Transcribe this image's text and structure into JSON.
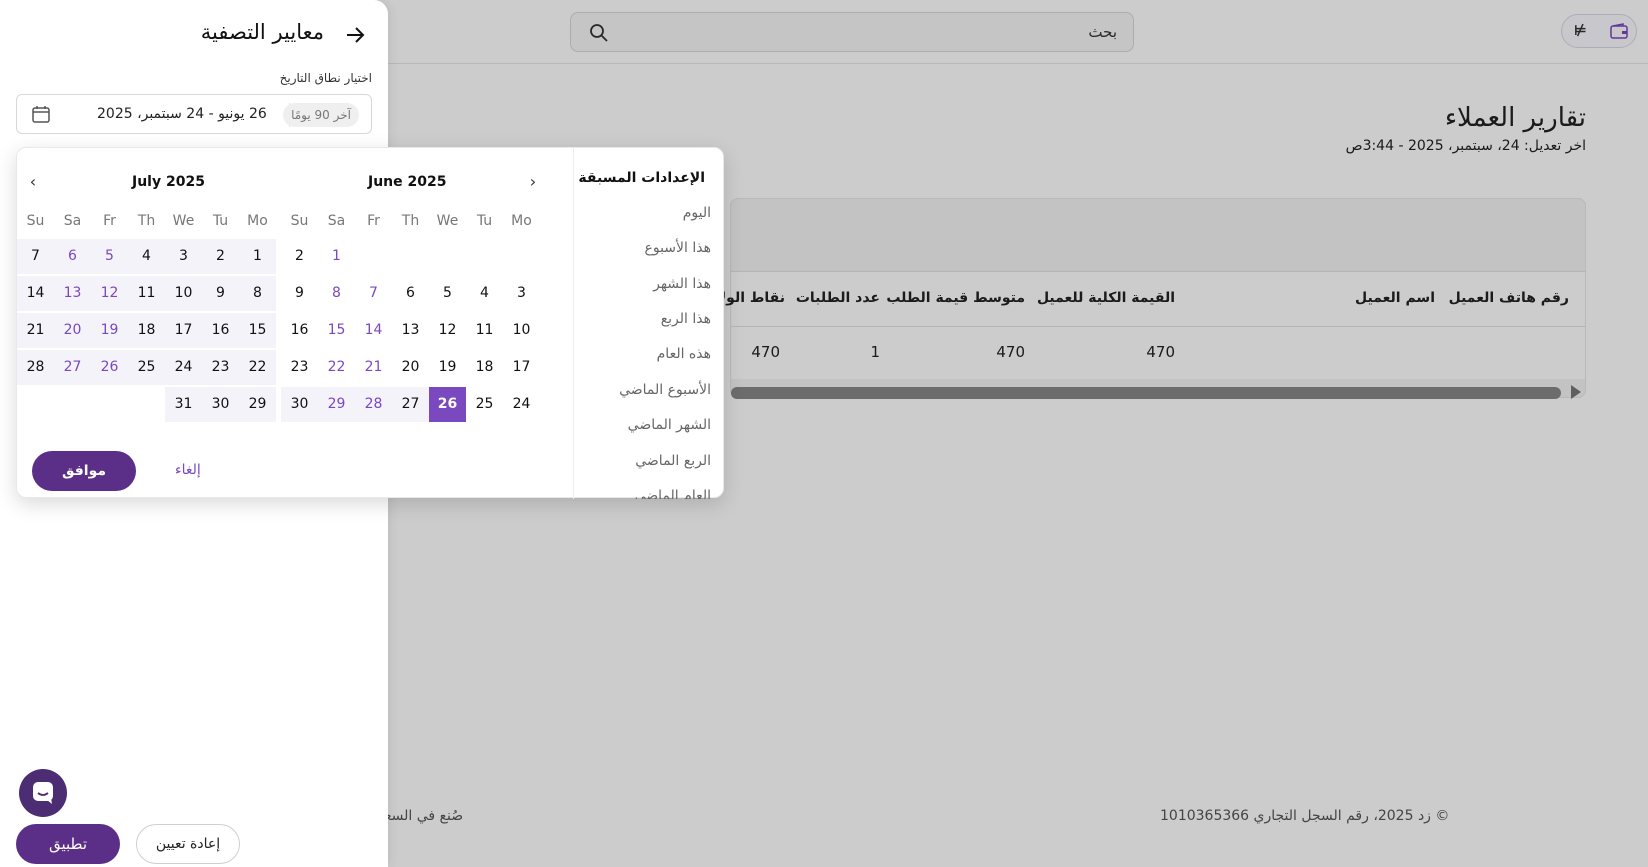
{
  "topbar": {
    "search_placeholder": "بحث",
    "currency_symbol": "⃁"
  },
  "page": {
    "title": "تقارير العملاء",
    "subtitle": "اخر تعديل: 24، سبتمبر، 2025 - 3:44ص"
  },
  "table": {
    "headers": [
      "رقم هاتف العميل",
      "اسم العميل",
      "القيمة الكلية للعميل",
      "متوسط قيمة الطلب",
      "عدد الطلبات",
      "نقاط الولاء"
    ],
    "row": [
      "",
      "",
      "470",
      "470",
      "1",
      "470"
    ]
  },
  "footer": {
    "copyright": "© زد 2025، رقم السجل التجاري 1010365366",
    "made_in": "صُنع في السعودية"
  },
  "filter_panel": {
    "title": "معايير التصفية",
    "range_label": "اختيار نطاق التاريخ",
    "range_value": "26 يونيو - 24 سبتمبر، 2025",
    "range_badge": "آخر 90 يومًا",
    "apply_label": "تطبيق",
    "reset_label": "إعادة تعيين"
  },
  "picker": {
    "presets_title": "الإعدادات المسبقة",
    "presets": [
      "اليوم",
      "هذا الأسبوع",
      "هذا الشهر",
      "هذا الربع",
      "هذه العام",
      "الأسبوع الماضي",
      "الشهر الماضي",
      "الربع الماضي",
      "العام الماضي"
    ],
    "weekdays": [
      "Mo",
      "Tu",
      "We",
      "Th",
      "Fr",
      "Sa",
      "Su"
    ],
    "months": [
      {
        "title": "June 2025",
        "first_weekday": 6,
        "days": 30,
        "range_from": 26
      },
      {
        "title": "July 2025",
        "first_weekday": 1,
        "days": 31,
        "range_from": 1
      }
    ],
    "selected_day": 26,
    "ok_label": "موافق",
    "cancel_label": "إلغاء"
  },
  "colors": {
    "accent": "#7a48bf",
    "primary_button": "#5b2f87"
  }
}
